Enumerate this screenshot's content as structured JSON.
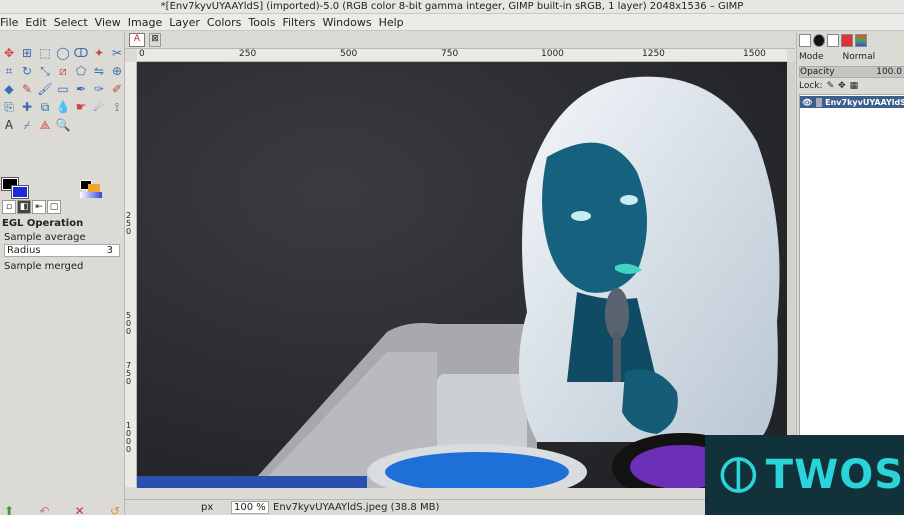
{
  "window": {
    "title": "*[Env7kyvUYAAYldS] (imported)-5.0 (RGB color 8-bit gamma integer, GIMP built-in sRGB, 1 layer) 2048x1536 – GIMP"
  },
  "menu": [
    "File",
    "Edit",
    "Select",
    "View",
    "Image",
    "Layer",
    "Colors",
    "Tools",
    "Filters",
    "Windows",
    "Help"
  ],
  "toolbox": {
    "tools": [
      {
        "icon": "move-icon",
        "glyph": "✥"
      },
      {
        "icon": "align-icon",
        "glyph": "⊞"
      },
      {
        "icon": "rect-select-icon",
        "glyph": "⬚"
      },
      {
        "icon": "ellipse-select-icon",
        "glyph": "◯"
      },
      {
        "icon": "free-select-icon",
        "glyph": "ↀ"
      },
      {
        "icon": "fuzzy-select-icon",
        "glyph": "✦"
      },
      {
        "icon": "scissors-icon",
        "glyph": "✂"
      },
      {
        "icon": "crop-icon",
        "glyph": "⌗"
      },
      {
        "icon": "rotate-icon",
        "glyph": "↻"
      },
      {
        "icon": "scale-icon",
        "glyph": "⤡"
      },
      {
        "icon": "shear-icon",
        "glyph": "⧄"
      },
      {
        "icon": "perspective-icon",
        "glyph": "⬠"
      },
      {
        "icon": "flip-icon",
        "glyph": "⇋"
      },
      {
        "icon": "cage-icon",
        "glyph": "⊕"
      },
      {
        "icon": "bucket-fill-icon",
        "glyph": "◆"
      },
      {
        "icon": "pencil-icon",
        "glyph": "✎"
      },
      {
        "icon": "paintbrush-icon",
        "glyph": "🖌"
      },
      {
        "icon": "eraser-icon",
        "glyph": "▭"
      },
      {
        "icon": "airbrush-icon",
        "glyph": "✒"
      },
      {
        "icon": "ink-icon",
        "glyph": "✑"
      },
      {
        "icon": "mypaint-brush-icon",
        "glyph": "✐"
      },
      {
        "icon": "clone-icon",
        "glyph": "⎘"
      },
      {
        "icon": "heal-icon",
        "glyph": "✚"
      },
      {
        "icon": "perspective-clone-icon",
        "glyph": "⧉"
      },
      {
        "icon": "blur-icon",
        "glyph": "💧"
      },
      {
        "icon": "smudge-icon",
        "glyph": "☛"
      },
      {
        "icon": "dodge-burn-icon",
        "glyph": "☄"
      },
      {
        "icon": "path-icon",
        "glyph": "⟟"
      },
      {
        "icon": "text-icon",
        "glyph": "A"
      },
      {
        "icon": "color-picker-icon",
        "glyph": "⌿"
      },
      {
        "icon": "measure-icon",
        "glyph": "⟁"
      },
      {
        "icon": "zoom-icon",
        "glyph": "🔍"
      }
    ],
    "options": {
      "title": "EGL Operation",
      "sample_average": "Sample average",
      "radius_label": "Radius",
      "radius_value": "3",
      "sample_merged": "Sample merged"
    },
    "colors": {
      "foreground": "#000000",
      "background": "#1f2bd8"
    }
  },
  "canvas": {
    "ruler_h": [
      "0",
      "250",
      "500",
      "750",
      "1000",
      "1250",
      "1500"
    ],
    "ruler_v": [
      "250",
      "500",
      "750",
      "1000"
    ],
    "status": {
      "unit": "px",
      "zoom": "100 %",
      "file_info": "Env7kyvUYAAYldS.jpeg (38.8 MB)"
    }
  },
  "layers": {
    "mode_label": "Mode",
    "mode_value": "Normal",
    "opacity_label": "Opacity",
    "opacity_value": "100.0",
    "lock_label": "Lock:",
    "layer_name": "Env7kyvUYAAYldS"
  },
  "watermark": {
    "text": "TWOS"
  }
}
